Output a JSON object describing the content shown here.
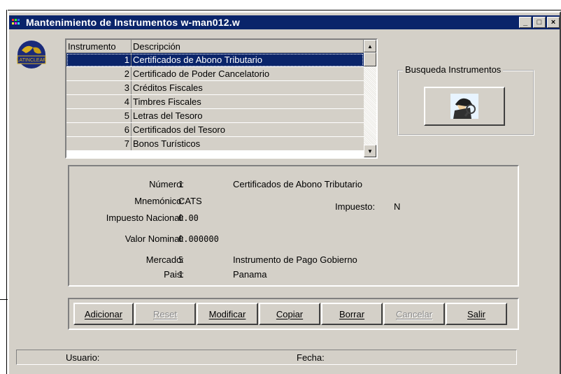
{
  "window": {
    "title": "Mantenimiento de Instrumentos w-man012.w",
    "minimize_glyph": "_",
    "maximize_glyph": "□",
    "close_glyph": "×"
  },
  "logo": {
    "text": "LATINCLEAR"
  },
  "list": {
    "header_num": "Instrumento",
    "header_desc": "Descripción",
    "rows": [
      {
        "num": "1",
        "desc": "Certificados de Abono Tributario"
      },
      {
        "num": "2",
        "desc": "Certificado de Poder Cancelatorio"
      },
      {
        "num": "3",
        "desc": "Créditos Fiscales"
      },
      {
        "num": "4",
        "desc": "Timbres Fiscales"
      },
      {
        "num": "5",
        "desc": "Letras del Tesoro"
      },
      {
        "num": "6",
        "desc": "Certificados del Tesoro"
      },
      {
        "num": "7",
        "desc": "Bonos Turísticos"
      }
    ],
    "selected_index": 0
  },
  "search": {
    "group_label": "Busqueda Instrumentos",
    "icon": "detective-search-icon"
  },
  "details": {
    "numero_label": "Número:",
    "numero_value": "1",
    "numero_desc": "Certificados de Abono Tributario",
    "mnemonico_label": "Mnemónico:",
    "mnemonico_value": "CATS",
    "impuesto_label": "Impuesto:",
    "impuesto_value": "N",
    "impuesto_nacional_label": "Impuesto Nacional:",
    "impuesto_nacional_value": "0.00",
    "valor_nominal_label": "Valor Nominal:",
    "valor_nominal_value": "0.000000",
    "mercado_label": "Mercado:",
    "mercado_value": "5",
    "mercado_desc": "Instrumento de Pago Gobierno",
    "pais_label": "Pais:",
    "pais_value": "1",
    "pais_desc": "Panama"
  },
  "buttons": [
    {
      "label": "Adicionar",
      "enabled": true
    },
    {
      "label": "Reset",
      "enabled": false
    },
    {
      "label": "Modificar",
      "enabled": true
    },
    {
      "label": "Copiar",
      "enabled": true
    },
    {
      "label": "Borrar",
      "enabled": true
    },
    {
      "label": "Cancelar",
      "enabled": false
    },
    {
      "label": "Salir",
      "enabled": true
    }
  ],
  "status": {
    "user_label": "Usuario:",
    "date_label": "Fecha:"
  },
  "colors": {
    "titlebar": "#0a246a",
    "face": "#d4d0c8",
    "selection": "#0a246a"
  }
}
